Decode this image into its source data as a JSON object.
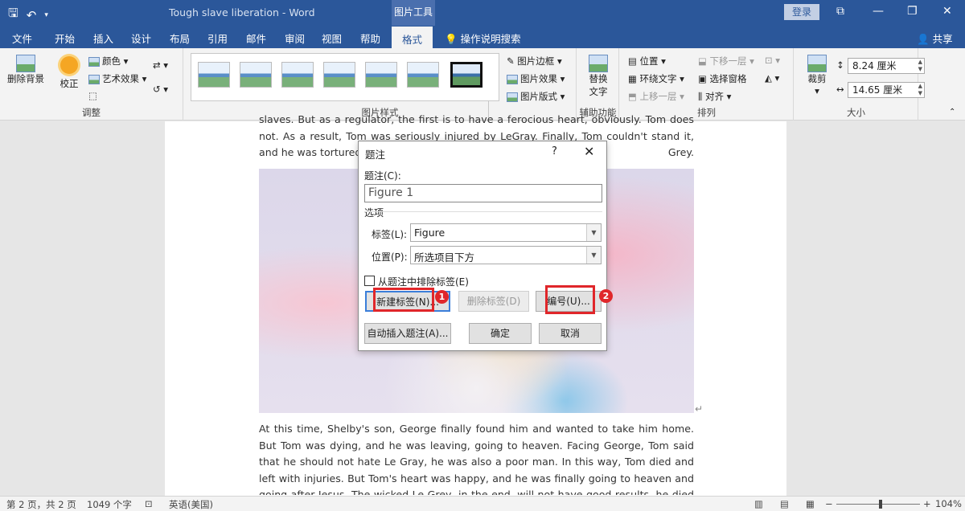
{
  "titlebar": {
    "doc_title": "Tough slave liberation - Word",
    "context_tab": "图片工具",
    "login": "登录",
    "qat_icons": [
      "save-icon",
      "undo-icon",
      "dropdown-icon"
    ]
  },
  "tabs": [
    "文件",
    "开始",
    "插入",
    "设计",
    "布局",
    "引用",
    "邮件",
    "审阅",
    "视图",
    "帮助",
    "格式"
  ],
  "tell_me": "操作说明搜索",
  "share": "共享",
  "ribbon": {
    "adjust": {
      "label": "调整",
      "remove_bg": "删除背景",
      "correct": "校正",
      "color": "颜色",
      "art_effects": "艺术效果"
    },
    "styles": {
      "label": "图片样式",
      "border": "图片边框",
      "effects": "图片效果",
      "layout": "图片版式"
    },
    "accessibility": {
      "label": "辅助功能",
      "alt_text_1": "替换",
      "alt_text_2": "文字"
    },
    "arrange": {
      "label": "排列",
      "position": "位置",
      "wrap_text": "环绕文字",
      "bring_forward": "上移一层",
      "send_backward": "下移一层",
      "selection_pane": "选择窗格",
      "align": "对齐"
    },
    "size": {
      "label": "大小",
      "crop": "裁剪",
      "height": "8.24 厘米",
      "width": "14.65 厘米"
    }
  },
  "document": {
    "para_top": "slaves. But as a regulator, the first is to have a ferocious heart, obviously. Tom does not. As a result, Tom was seriously injured by LeGray. Finally, Tom couldn't stand it, and he was tortured by",
    "para_top_end": "Grey.",
    "para_bottom": "At this time, Shelby's son, George finally found him and wanted to take him home. But Tom was dying, and he was leaving, going to heaven. Facing George, Tom said that he should not hate Le Gray, he was also a poor man. In this way, Tom died and left with injuries. But Tom's heart was happy, and he was finally going to heaven and going after Jesus. The wicked Le Grey, in the end, will not have good results, he died of death due to excessive drinking."
  },
  "dialog": {
    "title": "题注",
    "help": "?",
    "caption_label": "题注(C):",
    "caption_value": "Figure 1",
    "options_label": "选项",
    "tag_label": "标签(L):",
    "tag_value": "Figure",
    "position_label": "位置(P):",
    "position_value": "所选项目下方",
    "exclude_label": "从题注中排除标签(E)",
    "new_label_button": "新建标签(N)...",
    "delete_label_button": "删除标签(D)",
    "numbering_button": "编号(U)...",
    "autocaption_button": "自动插入题注(A)...",
    "ok_button": "确定",
    "cancel_button": "取消",
    "badge_1": "1",
    "badge_2": "2"
  },
  "statusbar": {
    "page": "第 2 页，共 2 页",
    "words": "1049 个字",
    "language": "英语(美国)",
    "zoom": "104%",
    "zoom_level_percent": 104
  }
}
